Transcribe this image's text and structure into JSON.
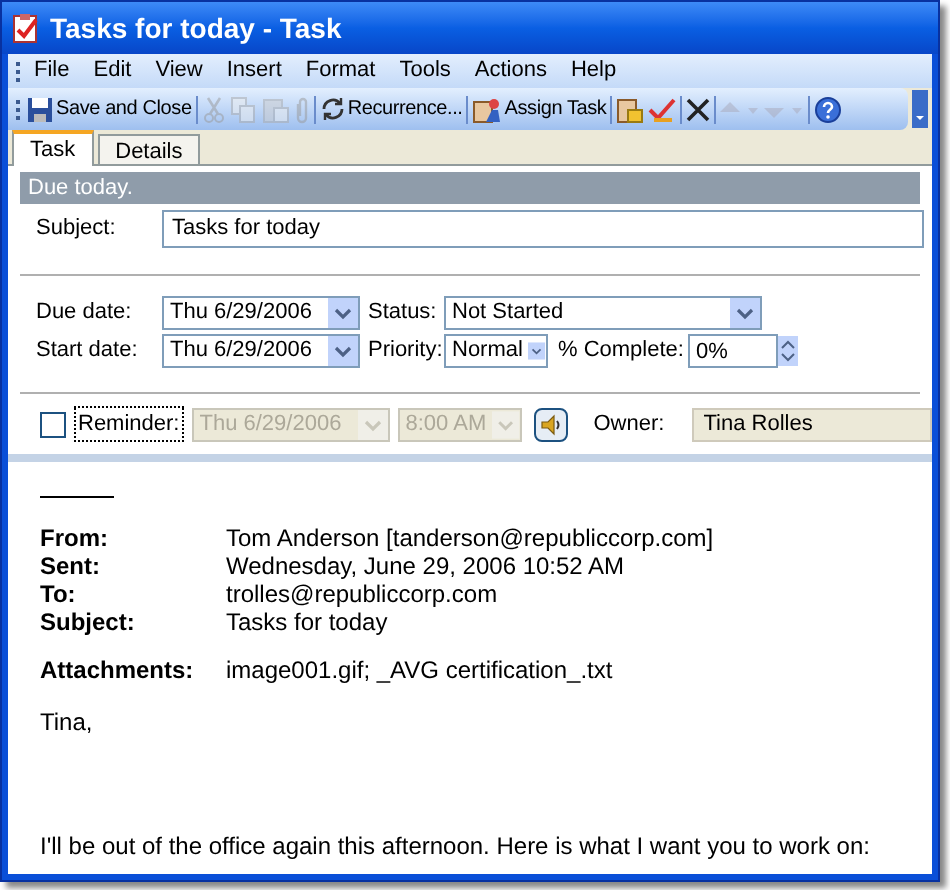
{
  "window": {
    "title": "Tasks for today - Task"
  },
  "menu": [
    {
      "label": "File"
    },
    {
      "label": "Edit"
    },
    {
      "label": "View"
    },
    {
      "label": "Insert"
    },
    {
      "label": "Format"
    },
    {
      "label": "Tools"
    },
    {
      "label": "Actions"
    },
    {
      "label": "Help"
    }
  ],
  "toolbar": [
    {
      "kind": "save",
      "label": "Save and Close",
      "disabled": false
    },
    {
      "kind": "separator"
    },
    {
      "kind": "cut",
      "disabled": true
    },
    {
      "kind": "copy",
      "disabled": true
    },
    {
      "kind": "paste",
      "disabled": true
    },
    {
      "kind": "attach",
      "disabled": true
    },
    {
      "kind": "separator"
    },
    {
      "kind": "recurrence",
      "label": "Recurrence...",
      "disabled": false
    },
    {
      "kind": "separator"
    },
    {
      "kind": "assign",
      "label": "Assign Task",
      "disabled": false
    },
    {
      "kind": "separator"
    },
    {
      "kind": "report",
      "disabled": false
    },
    {
      "kind": "complete",
      "disabled": false
    },
    {
      "kind": "separator"
    },
    {
      "kind": "delete",
      "disabled": false
    },
    {
      "kind": "separator"
    },
    {
      "kind": "previous",
      "disabled": true
    },
    {
      "kind": "next",
      "disabled": true
    },
    {
      "kind": "separator"
    },
    {
      "kind": "help",
      "disabled": false
    }
  ],
  "tabs": [
    {
      "label": "Task",
      "selected": true
    },
    {
      "label": "Details",
      "selected": false
    }
  ],
  "banner": "Due today.",
  "subject": {
    "label": "Subject:",
    "value": "Tasks for today"
  },
  "due_date": {
    "label": "Due date:",
    "value": "Thu 6/29/2006"
  },
  "status": {
    "label": "Status:",
    "value": "Not Started"
  },
  "start_date": {
    "label": "Start date:",
    "value": "Thu 6/29/2006"
  },
  "priority": {
    "label": "Priority:",
    "value": "Normal"
  },
  "percent_complete": {
    "label": "% Complete:",
    "value": "0%"
  },
  "reminder": {
    "label": "Reminder:",
    "checked": false,
    "date": "Thu 6/29/2006",
    "time": "8:00 AM"
  },
  "owner": {
    "label": "Owner:",
    "value": "Tina Rolles"
  },
  "email": {
    "headers": [
      {
        "label": "From:",
        "value": "Tom Anderson [tanderson@republiccorp.com]"
      },
      {
        "label": "Sent:",
        "value": "Wednesday, June 29, 2006 10:52 AM"
      },
      {
        "label": "To:",
        "value": "trolles@republiccorp.com"
      },
      {
        "label": "Subject:",
        "value": "Tasks for today"
      }
    ],
    "attachments": {
      "label": "Attachments:",
      "value": "image001.gif; _AVG certification_.txt"
    },
    "greeting": "Tina,",
    "paragraph": "I'll be out of the office again this afternoon. Here is what I want you to work on:"
  }
}
